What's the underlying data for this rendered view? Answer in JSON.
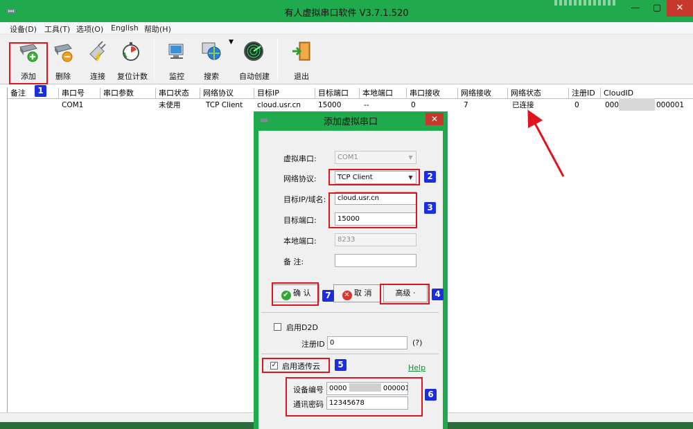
{
  "window": {
    "title": "有人虚拟串口软件 V3.7.1.520",
    "minimize": "—",
    "maximize": "▢",
    "close": "✕"
  },
  "menu": [
    "设备(D)",
    "工具(T)",
    "选项(O)",
    "English",
    "帮助(H)"
  ],
  "toolbar": [
    {
      "label": "添加",
      "icon": "serial-port-add-icon"
    },
    {
      "label": "删除",
      "icon": "serial-port-remove-icon"
    },
    {
      "label": "连接",
      "icon": "plug-connect-icon"
    },
    {
      "label": "复位计数",
      "icon": "stopwatch-reset-icon"
    },
    {
      "label": "监控",
      "icon": "monitor-computer-icon"
    },
    {
      "label": "搜索",
      "icon": "globe-search-icon"
    },
    {
      "label": "自动创建",
      "icon": "radar-icon"
    },
    {
      "label": "退出",
      "icon": "exit-door-icon"
    }
  ],
  "table": {
    "columns": [
      "备注",
      "串口号",
      "串口参数",
      "串口状态",
      "网络协议",
      "目标IP",
      "目标端口",
      "本地端口",
      "串口接收",
      "网络接收",
      "网络状态",
      "注册ID",
      "CloudID"
    ],
    "rows": [
      {
        "remark": "",
        "port": "COM1",
        "params": "",
        "port_status": "未使用",
        "protocol": "TCP Client",
        "target_ip": "cloud.usr.cn",
        "target_port": "15000",
        "local_port": "--",
        "serial_rx": "0",
        "net_rx": "7",
        "net_status": "已连接",
        "reg_id": "0",
        "cloud_id_prefix": "0000",
        "cloud_id_suffix": "000001"
      }
    ]
  },
  "dialog": {
    "title": "添加虚拟串口",
    "close": "✕",
    "virtual_port_label": "虚拟串口:",
    "virtual_port_value": "COM1",
    "protocol_label": "网络协议:",
    "protocol_value": "TCP Client",
    "target_ip_label": "目标IP/域名:",
    "target_ip_value": "cloud.usr.cn",
    "target_port_label": "目标端口:",
    "target_port_value": "15000",
    "local_port_label": "本地端口:",
    "local_port_value": "8233",
    "remark_label": "备  注:",
    "remark_value": "",
    "ok_label": "确 认",
    "cancel_label": "取 消",
    "advanced_label": "高级 ·",
    "d2d_label": "启用D2D",
    "reg_id_label": "注册ID",
    "reg_id_value": "0",
    "reg_id_help": "(?)",
    "cloud_label": "启用透传云",
    "help_label": "Help",
    "device_no_label": "设备编号",
    "device_no_prefix": "0000",
    "device_no_suffix": "000001",
    "password_label": "通讯密码",
    "password_value": "12345678"
  },
  "annotations": [
    "1",
    "2",
    "3",
    "4",
    "5",
    "6",
    "7"
  ],
  "colors": {
    "titlebar": "#1faa4e",
    "close": "#c7382c",
    "annotation_box": "#e0141c",
    "badge": "#1b2de0"
  }
}
